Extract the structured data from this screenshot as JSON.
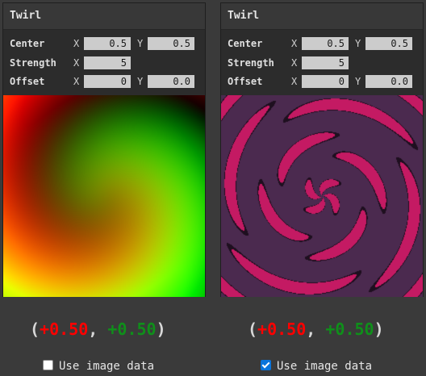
{
  "colors": {
    "background": "#3a3a3a",
    "panel": "#2c2c2c",
    "header": "#383838",
    "field": "#cccccc",
    "red_value": "#ff0000",
    "green_value": "#0f8f1a",
    "pattern_fill": "#4b2a4f",
    "pattern_band": "#c41a63",
    "pattern_outline": "#1e0f1f"
  },
  "nodes": [
    {
      "title": "Twirl",
      "center": {
        "label": "Center",
        "x_axis": "X",
        "x": "0.5",
        "y_axis": "Y",
        "y": "0.5"
      },
      "strength": {
        "label": "Strength",
        "x_axis": "X",
        "x": "5"
      },
      "offset": {
        "label": "Offset",
        "x_axis": "X",
        "x": "0",
        "y_axis": "Y",
        "y": "0.0"
      },
      "preview": "uv-gradient-twirl",
      "readout": {
        "open": "(",
        "x": "+0.50",
        "sep": ", ",
        "y": "+0.50",
        "close": ")"
      },
      "checkbox": {
        "label": "Use image data",
        "checked": false
      }
    },
    {
      "title": "Twirl",
      "center": {
        "label": "Center",
        "x_axis": "X",
        "x": "0.5",
        "y_axis": "Y",
        "y": "0.5"
      },
      "strength": {
        "label": "Strength",
        "x_axis": "X",
        "x": "5"
      },
      "offset": {
        "label": "Offset",
        "x_axis": "X",
        "x": "0",
        "y_axis": "Y",
        "y": "0.0"
      },
      "preview": "image-data-twirl",
      "readout": {
        "open": "(",
        "x": "+0.50",
        "sep": ", ",
        "y": "+0.50",
        "close": ")"
      },
      "checkbox": {
        "label": "Use image data",
        "checked": true
      }
    }
  ]
}
